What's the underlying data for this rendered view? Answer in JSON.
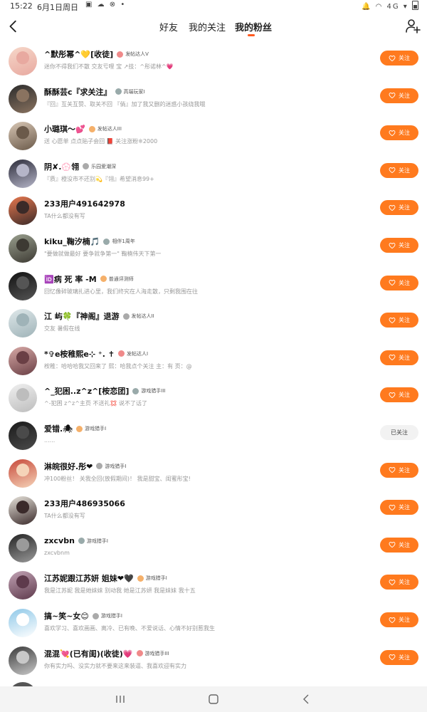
{
  "status": {
    "time": "15:22",
    "date": "6月1日周日",
    "left_icons": "▣ ☁ ⊗ •",
    "right_icons": "🔔 ◠ 4G ▾"
  },
  "nav": {
    "tabs": [
      {
        "label": "好友",
        "active": false
      },
      {
        "label": "我的关注",
        "active": false
      },
      {
        "label": "我的粉丝",
        "active": true
      }
    ],
    "accent": "#ff5a1f"
  },
  "follow_label": "关注",
  "followed_label": "已关注",
  "fans": [
    {
      "name": "^默彤幂^💛[收徒]",
      "badge": "发帖达人V",
      "bio": "迷你不得我们不散 交友亏哩 宝 ↗技：^彤诺林^💗",
      "followed": false,
      "av": [
        "#f6d7c9",
        "#e8a9a0"
      ]
    },
    {
      "name": "酥酥芸c『求关注』",
      "badge": "高端玩家I",
      "bio": "『回』互关互赞、取关不回 『倘』加了我又删的迷惑小孩绕我哦",
      "followed": false,
      "av": [
        "#2b2b2b",
        "#8a7360"
      ]
    },
    {
      "name": "小璐琪〜💕",
      "badge": "发帖达人III",
      "bio": "送 心愿单 点点贴子会回 📕 关注涨粉※2000",
      "followed": false,
      "av": [
        "#d8c7b5",
        "#6b5a4a"
      ]
    },
    {
      "name": "阴✘.💮翎",
      "badge": "乐园爱潮深",
      "bio": "『质』橙没市不还别💫『翎』希望消息99+",
      "followed": false,
      "av": [
        "#2c2c3a",
        "#b5b5c8"
      ]
    },
    {
      "name": "233用户491642978",
      "badge": "",
      "bio": "TA什么都没有写",
      "followed": false,
      "av": [
        "#e8784f",
        "#3b2a28"
      ]
    },
    {
      "name": "kiku_鞠汐楠🎵",
      "badge": "相伴1周年",
      "bio": "\"要做就做最好 要争就争第一\" 鞠楠伟天下第一",
      "followed": false,
      "av": [
        "#9aa08f",
        "#3d3a33"
      ]
    },
    {
      "name": "🆔病 死 率 -M",
      "badge": "普通评测师",
      "bio": "回忆像碎玻璃扎进心里，我们终究在人海走散，只剩我围在往",
      "followed": false,
      "av": [
        "#111111",
        "#555555"
      ]
    },
    {
      "name": "江 屿🍀『神阁』退游",
      "badge": "发帖达人II",
      "bio": "交友 暑假在线",
      "followed": false,
      "av": [
        "#dfe8ea",
        "#9fb3b8"
      ]
    },
    {
      "name": "*✞e桉稚熙e⊹ ⁺. ✝",
      "badge": "发帖达人I",
      "bio": "桉稚：哈哈哈我又回来了 熙：哈我点个关注 主：有 页：@",
      "followed": false,
      "av": [
        "#d7a9a6",
        "#6a3f45"
      ]
    },
    {
      "name": "^_犯困..z^z^[桉恋团]",
      "badge": "游戏猎手III",
      "bio": "^-犯困 z^z^主页 不送礼💢 说不了话了",
      "followed": false,
      "av": [
        "#f0f0f0",
        "#bdbdbd"
      ]
    },
    {
      "name": "爱错.🕷",
      "badge": "游戏猎手I",
      "bio": "......",
      "followed": true,
      "av": [
        "#1a1a1a",
        "#4a4a4a"
      ]
    },
    {
      "name": "淋皖很好.彤❤",
      "badge": "游戏猎手I",
      "bio": "冲100粉丝！ 关我全回(放假期间)！ 我是甜宝、闺蜜彤宝!",
      "followed": false,
      "av": [
        "#c7493a",
        "#f5d3b8"
      ]
    },
    {
      "name": "233用户486935066",
      "badge": "",
      "bio": "TA什么都没有写",
      "followed": false,
      "av": [
        "#e8e4dc",
        "#3a2a2a"
      ]
    },
    {
      "name": "zxcvbn",
      "badge": "游戏猎手I",
      "bio": "zxcvbnm",
      "followed": false,
      "av": [
        "#222222",
        "#9a9a9a"
      ]
    },
    {
      "name": "江苏妮跟江苏妍 姐妹❤🖤",
      "badge": "游戏猎手I",
      "bio": "我是江苏妮 我是她妹妹 别动我 她是江苏妍 我是妹妹 我十五",
      "followed": false,
      "av": [
        "#c2a3b5",
        "#5e3a4c"
      ]
    },
    {
      "name": "搞~笑~女😊",
      "badge": "游戏猎手I",
      "bio": "喜欢学习、喜欢画画、离冷、已有晚、不爱说话、心情不好别惹我生",
      "followed": false,
      "av": [
        "#8fc8e8",
        "#ffffff"
      ]
    },
    {
      "name": "混混💘(已有闺)(收徒)💗",
      "badge": "游戏猎手III",
      "bio": "你有实力吗、没实力就不要来这来装逼、我喜欢迎有实力",
      "followed": false,
      "av": [
        "#3a3a3a",
        "#c8c8c8"
      ]
    }
  ]
}
